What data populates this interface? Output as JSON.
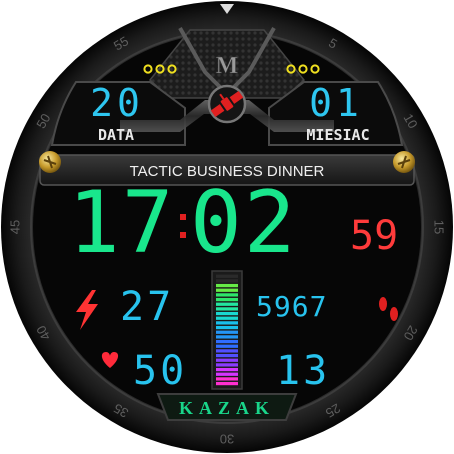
{
  "bezel": {
    "marks": [
      "5",
      "10",
      "15",
      "20",
      "25",
      "30",
      "35",
      "40",
      "45",
      "50",
      "55"
    ]
  },
  "brand_logo": "M",
  "date": {
    "day": "20",
    "day_label": "DATA",
    "month": "01",
    "month_label": "MIESIAC"
  },
  "event": "TACTIC BUSINESS DINNER",
  "time": {
    "hours": "17",
    "minutes": "02",
    "seconds": "59"
  },
  "stats": {
    "battery_level": "27",
    "steps": "5967",
    "heart_rate": "50",
    "floors": "13",
    "level_fraction": 0.9
  },
  "footer_brand": "KAZAK",
  "colors": {
    "time": "#19e68c",
    "seconds": "#ff3b3b",
    "date": "#2ec6f0",
    "stats": "#28c3ee",
    "label": "#e8e8e8",
    "bolt": "#ff3333",
    "heart": "#ff2a3a",
    "footsteps": "#e02020",
    "brand": "#19d58a",
    "indicator_dots": "#f0e020"
  },
  "icons": [
    "bolt-icon",
    "heart-icon",
    "footsteps-icon",
    "satellite-icon",
    "screw-icon"
  ]
}
